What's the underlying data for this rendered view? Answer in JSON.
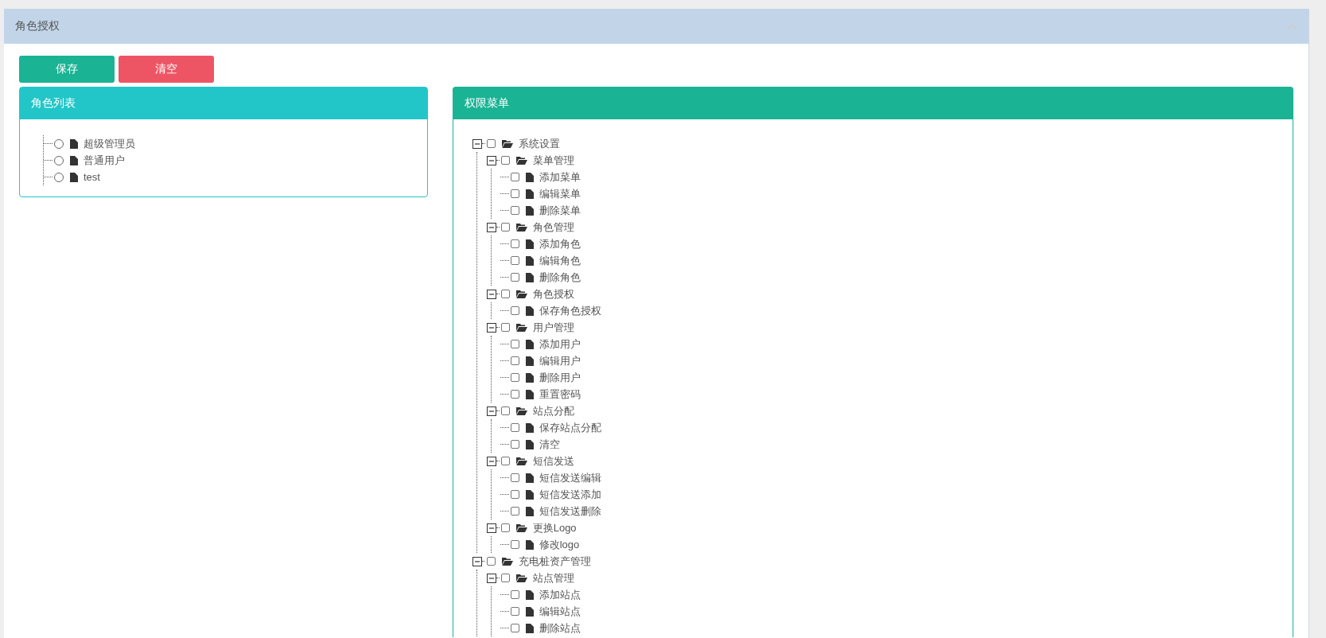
{
  "panel": {
    "title": "角色授权"
  },
  "buttons": [
    {
      "label": "保存",
      "kind": "save"
    },
    {
      "label": "清空",
      "kind": "clear"
    }
  ],
  "role_list": {
    "title": "角色列表",
    "items": [
      {
        "label": "超级管理员",
        "selected": false
      },
      {
        "label": "普通用户",
        "selected": false
      },
      {
        "label": "test",
        "selected": false
      }
    ]
  },
  "menu_tree": {
    "title": "权限菜单",
    "items": [
      {
        "label": "系统设置",
        "checked": false,
        "expanded": true,
        "children": [
          {
            "label": "菜单管理",
            "checked": false,
            "expanded": true,
            "children": [
              {
                "label": "添加菜单",
                "checked": false
              },
              {
                "label": "编辑菜单",
                "checked": false
              },
              {
                "label": "删除菜单",
                "checked": false
              }
            ]
          },
          {
            "label": "角色管理",
            "checked": false,
            "expanded": true,
            "children": [
              {
                "label": "添加角色",
                "checked": false
              },
              {
                "label": "编辑角色",
                "checked": false
              },
              {
                "label": "删除角色",
                "checked": false
              }
            ]
          },
          {
            "label": "角色授权",
            "checked": false,
            "expanded": true,
            "children": [
              {
                "label": "保存角色授权",
                "checked": false
              }
            ]
          },
          {
            "label": "用户管理",
            "checked": false,
            "expanded": true,
            "children": [
              {
                "label": "添加用户",
                "checked": false
              },
              {
                "label": "编辑用户",
                "checked": false
              },
              {
                "label": "删除用户",
                "checked": false
              },
              {
                "label": "重置密码",
                "checked": false
              }
            ]
          },
          {
            "label": "站点分配",
            "checked": false,
            "expanded": true,
            "children": [
              {
                "label": "保存站点分配",
                "checked": false
              },
              {
                "label": "清空",
                "checked": false
              }
            ]
          },
          {
            "label": "短信发送",
            "checked": false,
            "expanded": true,
            "children": [
              {
                "label": "短信发送编辑",
                "checked": false
              },
              {
                "label": "短信发送添加",
                "checked": false
              },
              {
                "label": "短信发送删除",
                "checked": false
              }
            ]
          },
          {
            "label": "更换Logo",
            "checked": false,
            "expanded": true,
            "children": [
              {
                "label": "修改logo",
                "checked": false
              }
            ]
          }
        ]
      },
      {
        "label": "充电桩资产管理",
        "checked": false,
        "expanded": true,
        "children": [
          {
            "label": "站点管理",
            "checked": false,
            "expanded": true,
            "children": [
              {
                "label": "添加站点",
                "checked": false
              },
              {
                "label": "编辑站点",
                "checked": false
              },
              {
                "label": "删除站点",
                "checked": false
              }
            ]
          }
        ]
      }
    ]
  }
}
